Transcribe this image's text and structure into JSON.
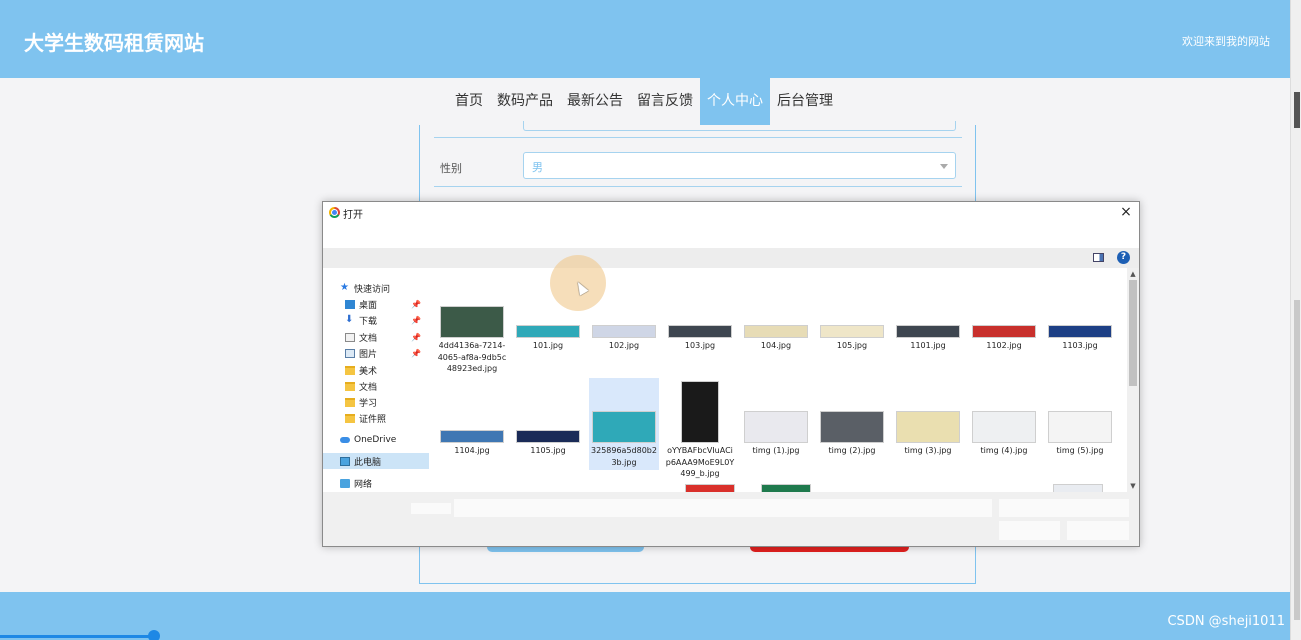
{
  "header": {
    "site_title": "大学生数码租赁网站",
    "welcome": "欢迎来到我的网站"
  },
  "nav": {
    "items": [
      {
        "label": "首页",
        "active": false
      },
      {
        "label": "数码产品",
        "active": false
      },
      {
        "label": "最新公告",
        "active": false
      },
      {
        "label": "留言反馈",
        "active": false
      },
      {
        "label": "个人中心",
        "active": true
      },
      {
        "label": "后台管理",
        "active": false
      }
    ]
  },
  "form": {
    "gender_label": "性别",
    "gender_value": "男"
  },
  "dialog": {
    "title": "打开",
    "close_glyph": "×",
    "help_glyph": "?",
    "nav_pane": [
      {
        "label": "快速访问",
        "icon": "star-icon",
        "pinned": false
      },
      {
        "label": "桌面",
        "icon": "desktop-icon",
        "pinned": true
      },
      {
        "label": "下载",
        "icon": "download-icon",
        "pinned": true
      },
      {
        "label": "文档",
        "icon": "document-icon",
        "pinned": true
      },
      {
        "label": "图片",
        "icon": "pictures-icon",
        "pinned": true
      },
      {
        "label": "美术",
        "icon": "folder-icon",
        "pinned": false
      },
      {
        "label": "文档",
        "icon": "folder-icon",
        "pinned": false
      },
      {
        "label": "学习",
        "icon": "folder-icon",
        "pinned": false
      },
      {
        "label": "证件照",
        "icon": "folder-icon",
        "pinned": false
      },
      {
        "label": "OneDrive",
        "icon": "onedrive-icon",
        "pinned": false
      },
      {
        "label": "此电脑",
        "icon": "this-pc-icon",
        "pinned": false,
        "selected": true
      },
      {
        "label": "网络",
        "icon": "network-icon",
        "pinned": false
      }
    ],
    "files_row1": [
      {
        "name": "4dd4136a-7214-4065-af8a-9db5c48923ed.jpg",
        "color": "#3c5a48"
      },
      {
        "name": "101.jpg",
        "color": "#2fa9b8"
      },
      {
        "name": "102.jpg",
        "color": "#cfd6e6"
      },
      {
        "name": "103.jpg",
        "color": "#3e4650"
      },
      {
        "name": "104.jpg",
        "color": "#e7dcb6"
      },
      {
        "name": "105.jpg",
        "color": "#efe6c8"
      },
      {
        "name": "1101.jpg",
        "color": "#3e4650"
      },
      {
        "name": "1102.jpg",
        "color": "#c8302c"
      },
      {
        "name": "1103.jpg",
        "color": "#1d3f85"
      }
    ],
    "files_row2": [
      {
        "name": "1104.jpg",
        "color": "#3f77b3"
      },
      {
        "name": "1105.jpg",
        "color": "#1a2b57"
      },
      {
        "name": "325896a5d80b23b.jpg",
        "color": "#2fa9b8",
        "selected": true
      },
      {
        "name": "oYYBAFbcVIuACip6AAA9MoE9L0Y499_b.jpg",
        "color": "#1a1a1a"
      },
      {
        "name": "timg (1).jpg",
        "color": "#e9e9ee"
      },
      {
        "name": "timg (2).jpg",
        "color": "#5a5f66"
      },
      {
        "name": "timg (3).jpg",
        "color": "#eadfb0"
      },
      {
        "name": "timg (4).jpg",
        "color": "#eef0f2"
      },
      {
        "name": "timg (5).jpg",
        "color": "#f4f4f4"
      }
    ]
  },
  "watermark": "CSDN @sheji1011",
  "colors": {
    "accent": "#7fc3ef",
    "danger": "#e1201f",
    "selection": "#cce4f7"
  }
}
